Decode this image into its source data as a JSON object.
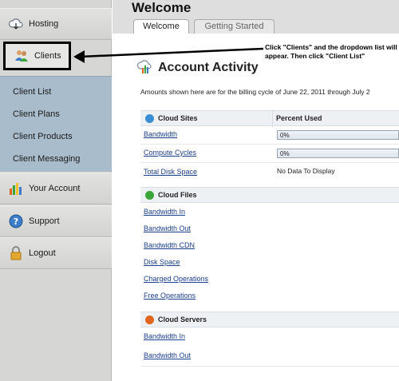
{
  "sidebar": {
    "hosting": "Hosting",
    "clients": "Clients",
    "submenu": [
      "Client List",
      "Client Plans",
      "Client Products",
      "Client Messaging"
    ],
    "your_account": "Your Account",
    "support": "Support",
    "logout": "Logout"
  },
  "header": {
    "title": "Welcome",
    "tabs": [
      "Welcome",
      "Getting Started"
    ],
    "active_tab": "Welcome"
  },
  "annotation": "Click \"Clients\" and the dropdown list will appear. Then click \"Client List\"",
  "main": {
    "title": "Account Activity",
    "billing": "Amounts shown here are for the billing cycle of June 22, 2011 through July 2",
    "percent_header": "Percent Used",
    "sections": [
      {
        "name": "Cloud Sites",
        "icon": "globe-icon",
        "color": "#3a8fd4",
        "rows": [
          {
            "label": "Bandwidth",
            "value": "0%",
            "percent": 0
          },
          {
            "label": "Compute Cycles",
            "value": "0%",
            "percent": 0
          },
          {
            "label": "Total Disk Space",
            "value": "No Data To Display"
          }
        ]
      },
      {
        "name": "Cloud Files",
        "icon": "files-icon",
        "color": "#3aa637",
        "rows": [
          {
            "label": "Bandwidth In"
          },
          {
            "label": "Bandwidth Out"
          },
          {
            "label": "Bandwidth CDN"
          },
          {
            "label": "Disk Space"
          },
          {
            "label": "Charged Operations"
          },
          {
            "label": "Free Operations"
          }
        ]
      },
      {
        "name": "Cloud Servers",
        "icon": "server-icon",
        "color": "#e0651f",
        "rows": [
          {
            "label": "Bandwidth In"
          },
          {
            "label": "Bandwidth Out"
          }
        ]
      }
    ]
  }
}
